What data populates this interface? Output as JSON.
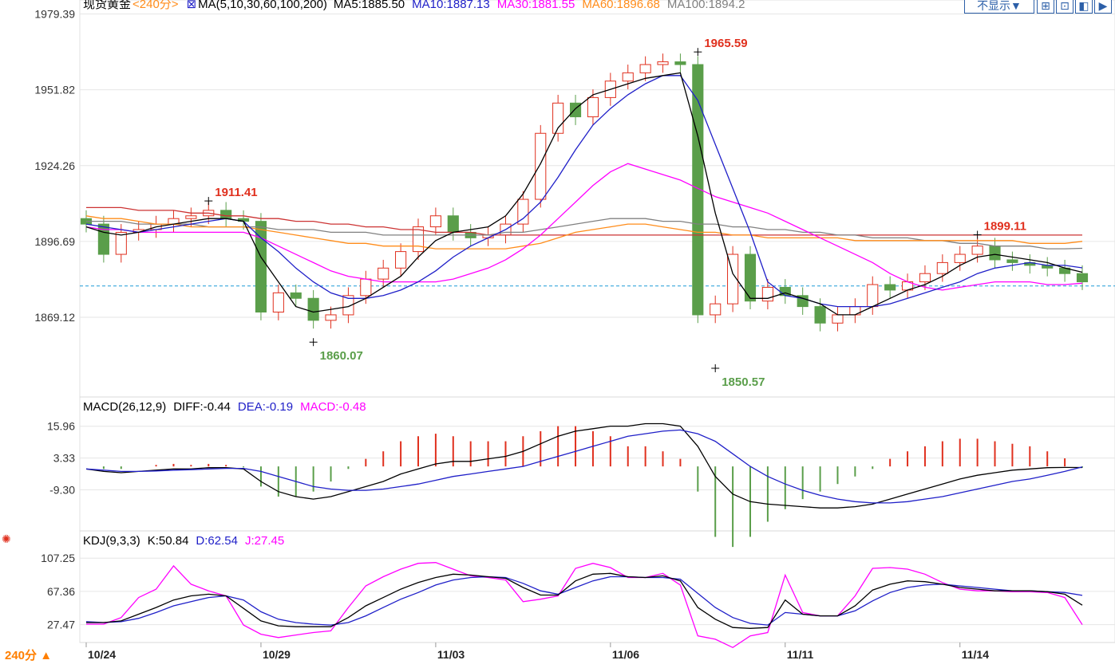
{
  "header": {
    "instrument": "现货黄金",
    "period_tag": "<240分>",
    "ma_label": "MA(5,10,30,60,100,200)",
    "ma_values": [
      {
        "text": "MA5:1885.50",
        "color": "#000000"
      },
      {
        "text": "MA10:1887.13",
        "color": "#1f1fc8"
      },
      {
        "text": "MA30:1881.55",
        "color": "#ff00ff"
      },
      {
        "text": "MA60:1896.68",
        "color": "#ff8c1a"
      },
      {
        "text": "MA100:1894.2",
        "color": "#808080"
      }
    ],
    "display_button": "不显示▼",
    "toolbar_icons": [
      "crosshair-icon",
      "overlay-icon",
      "split-icon",
      "play-icon"
    ]
  },
  "macd_header": {
    "label": "MACD(26,12,9)",
    "diff": "DIFF:-0.44",
    "dea": "DEA:-0.19",
    "macd": "MACD:-0.48"
  },
  "kdj_header": {
    "label": "KDJ(9,3,3)",
    "k": "K:50.84",
    "d": "D:62.54",
    "j": "J:27.45"
  },
  "period_selector": "240分 ▲",
  "colors": {
    "up": "#e0301e",
    "down": "#5a9e4a",
    "ma5": "#000000",
    "ma10": "#1f1fc8",
    "ma30": "#ff00ff",
    "ma60": "#ff8c1a",
    "ma100": "#808080",
    "ma200": "#cc3333",
    "axis_text": "#333333",
    "grid": "#e6e6e6",
    "ref_line": "#1e9bd7"
  },
  "chart_data": [
    {
      "type": "candlestick",
      "title": "现货黄金 240分",
      "ylim": [
        1841,
        1981
      ],
      "yticks": [
        "1979.39",
        "1951.82",
        "1924.26",
        "1896.69",
        "1869.12"
      ],
      "reference_price": 1880.5,
      "xticks": [
        {
          "label": "10/24",
          "index": 0
        },
        {
          "label": "10/29",
          "index": 10
        },
        {
          "label": "11/03",
          "index": 20
        },
        {
          "label": "11/06",
          "index": 30
        },
        {
          "label": "11/11",
          "index": 40
        },
        {
          "label": "11/14",
          "index": 50
        }
      ],
      "annotations": [
        {
          "text": "1911.41",
          "index": 7,
          "value": 1911.41,
          "kind": "high"
        },
        {
          "text": "1860.07",
          "index": 13,
          "value": 1860.07,
          "kind": "low"
        },
        {
          "text": "1965.59",
          "index": 35,
          "value": 1965.59,
          "kind": "high"
        },
        {
          "text": "1850.57",
          "index": 36,
          "value": 1850.57,
          "kind": "low"
        },
        {
          "text": "1899.11",
          "index": 51,
          "value": 1899.11,
          "kind": "high"
        }
      ],
      "close_line": [
        1903,
        1892,
        1900,
        1901,
        1903,
        1905,
        1906,
        1908,
        1905,
        1904,
        1871,
        1878,
        1876,
        1868,
        1870,
        1877,
        1883,
        1887,
        1893,
        1902,
        1906,
        1900,
        1898,
        1899,
        1903,
        1912,
        1936,
        1947,
        1942,
        1949,
        1955,
        1958,
        1961,
        1962,
        1961,
        1870,
        1874,
        1892,
        1875,
        1880,
        1877,
        1873,
        1867,
        1870,
        1873,
        1881,
        1879,
        1882,
        1885,
        1889,
        1892,
        1895,
        1890,
        1889,
        1888,
        1887,
        1885,
        1882
      ],
      "candles_estimated_from_close": true,
      "ma5": [
        1902,
        1900,
        1899,
        1900,
        1902,
        1903,
        1904,
        1905,
        1905,
        1904,
        1891,
        1882,
        1873,
        1871,
        1872,
        1873,
        1876,
        1880,
        1884,
        1891,
        1897,
        1900,
        1901,
        1902,
        1906,
        1914,
        1925,
        1938,
        1945,
        1950,
        1952,
        1954,
        1956,
        1957,
        1958,
        1935,
        1907,
        1885,
        1876,
        1876,
        1878,
        1876,
        1874,
        1870,
        1870,
        1873,
        1876,
        1879,
        1881,
        1884,
        1888,
        1891,
        1892,
        1891,
        1890,
        1889,
        1887,
        1885.5
      ],
      "ma10": [
        1903,
        1902,
        1901,
        1900,
        1901,
        1902,
        1903,
        1904,
        1905,
        1904,
        1898,
        1893,
        1887,
        1882,
        1878,
        1876,
        1876,
        1877,
        1879,
        1882,
        1886,
        1891,
        1895,
        1898,
        1901,
        1905,
        1911,
        1920,
        1930,
        1939,
        1945,
        1950,
        1954,
        1957,
        1957,
        1948,
        1932,
        1916,
        1900,
        1882,
        1877,
        1876,
        1874,
        1873,
        1873,
        1873,
        1874,
        1876,
        1878,
        1880,
        1882,
        1885,
        1887,
        1888,
        1889,
        1888,
        1888,
        1887.1
      ],
      "ma30": [
        1902,
        1901,
        1901,
        1900,
        1900,
        1900,
        1900,
        1900,
        1900,
        1900,
        1898,
        1895,
        1892,
        1889,
        1886,
        1884,
        1883,
        1882,
        1882,
        1882,
        1882,
        1883,
        1885,
        1887,
        1890,
        1894,
        1899,
        1905,
        1911,
        1917,
        1922,
        1925,
        1923,
        1921,
        1919,
        1916,
        1913,
        1911,
        1909,
        1907,
        1904,
        1901,
        1898,
        1895,
        1892,
        1889,
        1885,
        1882,
        1880,
        1879,
        1880,
        1881,
        1882,
        1882,
        1882,
        1881,
        1881,
        1881.5
      ],
      "ma60": [
        1906,
        1905,
        1905,
        1904,
        1903,
        1903,
        1902,
        1902,
        1902,
        1902,
        1901,
        1900,
        1899,
        1898,
        1897,
        1896,
        1896,
        1895,
        1895,
        1895,
        1894,
        1894,
        1894,
        1894,
        1894,
        1895,
        1896,
        1898,
        1900,
        1901,
        1902,
        1903,
        1903,
        1902,
        1901,
        1900,
        1900,
        1899,
        1899,
        1898,
        1898,
        1898,
        1898,
        1898,
        1897,
        1897,
        1897,
        1897,
        1897,
        1897,
        1897,
        1897,
        1897,
        1897,
        1896,
        1896,
        1896,
        1896.7
      ],
      "ma100": [
        1904,
        1904,
        1904,
        1903,
        1903,
        1903,
        1903,
        1902,
        1902,
        1902,
        1902,
        1901,
        1901,
        1901,
        1900,
        1900,
        1900,
        1899,
        1899,
        1899,
        1899,
        1899,
        1899,
        1899,
        1900,
        1900,
        1901,
        1902,
        1903,
        1904,
        1905,
        1905,
        1905,
        1904,
        1904,
        1903,
        1903,
        1902,
        1902,
        1901,
        1901,
        1900,
        1900,
        1899,
        1899,
        1898,
        1898,
        1898,
        1897,
        1897,
        1896,
        1896,
        1895,
        1895,
        1895,
        1894,
        1894,
        1894.2
      ],
      "ma200": [
        1909,
        1909,
        1909,
        1908,
        1908,
        1908,
        1907,
        1907,
        1906,
        1906,
        1905,
        1905,
        1904,
        1904,
        1903,
        1903,
        1902,
        1902,
        1901,
        1901,
        1900,
        1900,
        1900,
        1899,
        1899,
        1899,
        1899,
        1899,
        1899,
        1899,
        1899,
        1899,
        1899,
        1899,
        1899,
        1899,
        1899,
        1899,
        1899,
        1899,
        1899,
        1899,
        1899,
        1899,
        1899,
        1899,
        1899,
        1899,
        1899,
        1899,
        1899,
        1899,
        1899,
        1899,
        1899,
        1899,
        1899,
        1899
      ]
    },
    {
      "type": "line",
      "title": "MACD(26,12,9)",
      "ylim": [
        -25,
        20
      ],
      "yticks": [
        "15.96",
        "3.33",
        "-9.30"
      ],
      "series": [
        {
          "name": "DIFF",
          "values": [
            -1,
            -2,
            -2.5,
            -2,
            -1.5,
            -1,
            -1,
            -0.5,
            -0.5,
            -1,
            -6,
            -10,
            -12,
            -13,
            -12,
            -10,
            -8,
            -6,
            -3,
            -1,
            1,
            2,
            2,
            3,
            4,
            6,
            9,
            12,
            14,
            15,
            16,
            16,
            17,
            17,
            16,
            8,
            -4,
            -11,
            -14,
            -15,
            -15.5,
            -16,
            -16.5,
            -16.5,
            -16,
            -15,
            -13,
            -11,
            -9,
            -7,
            -5,
            -3.5,
            -2.5,
            -1.5,
            -1,
            -0.5,
            -0.4,
            -0.44
          ]
        },
        {
          "name": "DEA",
          "values": [
            -1,
            -1.5,
            -2,
            -2,
            -1.8,
            -1.5,
            -1.3,
            -1,
            -0.8,
            -0.8,
            -2,
            -4,
            -6,
            -8,
            -9,
            -9.5,
            -9.5,
            -9,
            -8,
            -7,
            -5.5,
            -4,
            -3,
            -2,
            -1,
            0,
            2,
            4,
            6,
            8,
            10,
            12,
            13,
            14,
            14.5,
            13,
            10,
            5,
            0,
            -4,
            -7,
            -9.5,
            -11.5,
            -13,
            -14,
            -14.5,
            -14.5,
            -14,
            -13,
            -12,
            -10.5,
            -9,
            -7.5,
            -6,
            -5,
            -3.5,
            -2,
            -0.19
          ]
        }
      ]
    },
    {
      "type": "line",
      "title": "KDJ(9,3,3)",
      "ylim": [
        7,
        117
      ],
      "yticks": [
        "107.25",
        "67.36",
        "27.47"
      ],
      "series": [
        {
          "name": "K",
          "values": [
            30,
            30,
            32,
            40,
            48,
            57,
            62,
            64,
            62,
            47,
            32,
            26,
            25,
            25,
            25,
            36,
            50,
            60,
            70,
            78,
            84,
            88,
            87,
            85,
            83,
            72,
            63,
            63,
            80,
            88,
            89,
            85,
            84,
            86,
            80,
            48,
            34,
            24,
            23,
            24,
            57,
            40,
            38,
            38,
            50,
            69,
            76,
            80,
            79,
            76,
            72,
            70,
            68,
            68,
            68,
            67,
            64,
            50.84
          ]
        },
        {
          "name": "D",
          "values": [
            31,
            30,
            31,
            35,
            42,
            50,
            55,
            60,
            62,
            57,
            43,
            34,
            30,
            28,
            27,
            30,
            38,
            48,
            58,
            66,
            75,
            81,
            84,
            85,
            84,
            77,
            68,
            64,
            72,
            80,
            85,
            85,
            84,
            84,
            82,
            65,
            48,
            36,
            29,
            27,
            42,
            40,
            38,
            38,
            44,
            56,
            66,
            72,
            75,
            76,
            74,
            72,
            70,
            68,
            68,
            67,
            66,
            62.54
          ]
        },
        {
          "name": "J",
          "values": [
            28,
            28,
            36,
            60,
            70,
            98,
            76,
            68,
            62,
            27,
            16,
            12,
            15,
            18,
            20,
            48,
            74,
            85,
            94,
            101,
            102,
            94,
            86,
            84,
            81,
            55,
            58,
            62,
            95,
            101,
            96,
            84,
            84,
            89,
            75,
            14,
            10,
            0,
            14,
            18,
            87,
            42,
            38,
            38,
            62,
            95,
            96,
            94,
            88,
            78,
            70,
            68,
            68,
            67,
            67,
            66,
            60,
            27.45
          ]
        }
      ],
      "histogram_note": "MACD bars drawn from DIFF-DEA"
    }
  ]
}
